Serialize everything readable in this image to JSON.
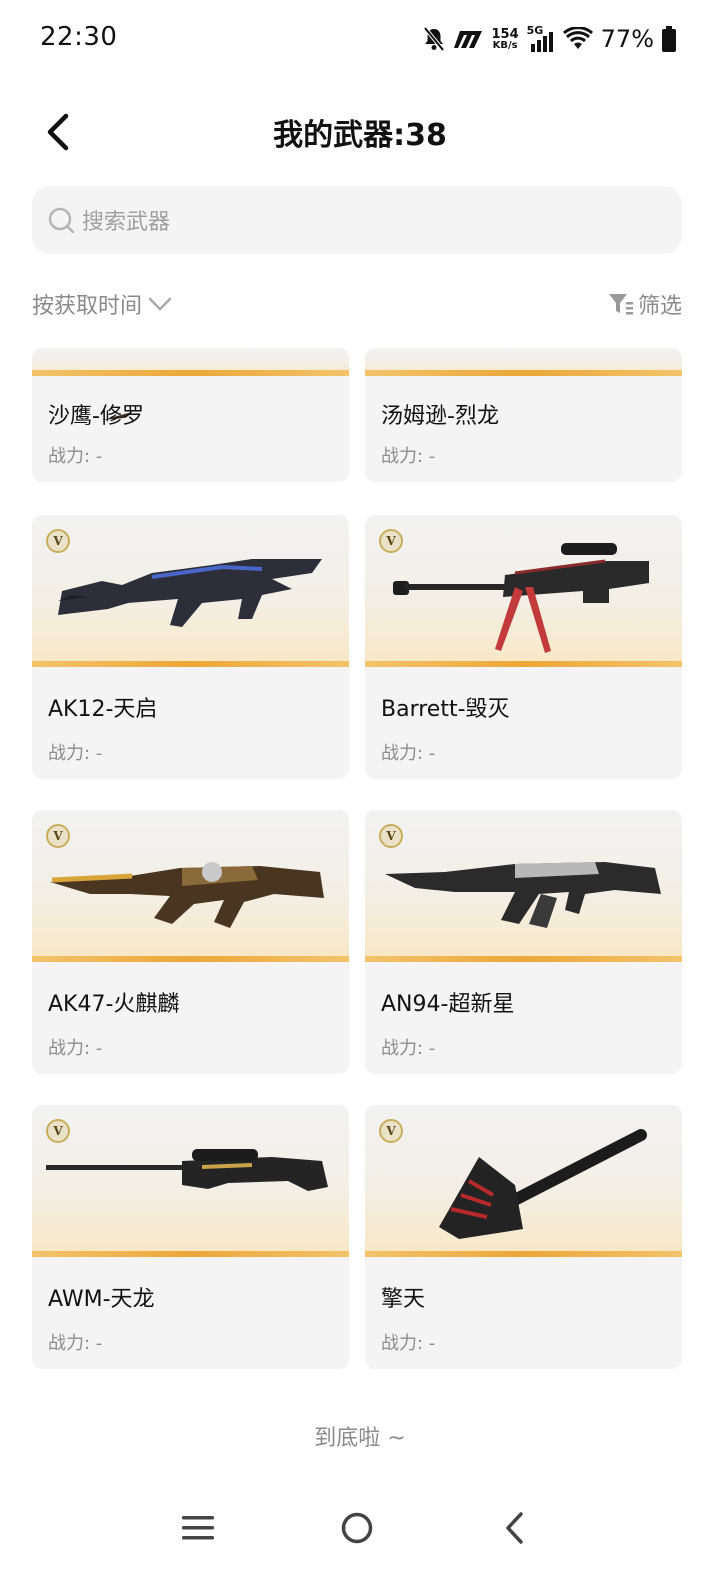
{
  "status_bar": {
    "time": "22:30",
    "net_speed_value": "154",
    "net_speed_unit": "KB/s",
    "network_type": "5G",
    "battery_percent": "77%",
    "icons": [
      "bell-mute-icon",
      "nfc-icon",
      "signal-icon",
      "wifi-icon",
      "battery-icon"
    ]
  },
  "header": {
    "title": "我的武器:38"
  },
  "search": {
    "placeholder": "搜索武器"
  },
  "toolbar": {
    "sort_label": "按获取时间",
    "filter_label": "筛选"
  },
  "weapons": [
    {
      "name": "沙鹰-修罗",
      "power": "战力: -"
    },
    {
      "name": "汤姆逊-烈龙",
      "power": "战力: -"
    },
    {
      "name": "AK12-天启",
      "power": "战力: -",
      "badge": "V"
    },
    {
      "name": "Barrett-毁灭",
      "power": "战力: -",
      "badge": "V"
    },
    {
      "name": "AK47-火麒麟",
      "power": "战力: -",
      "badge": "V"
    },
    {
      "name": "AN94-超新星",
      "power": "战力: -",
      "badge": "V"
    },
    {
      "name": "AWM-天龙",
      "power": "战力: -",
      "badge": "V"
    },
    {
      "name": "擎天",
      "power": "战力: -",
      "badge": "V"
    }
  ],
  "footer": {
    "end_text": "到底啦 ~"
  },
  "colors": {
    "accent_gold": "#eba73a",
    "card_bg": "#f4f4f4",
    "muted_text": "#8a8a8a"
  }
}
